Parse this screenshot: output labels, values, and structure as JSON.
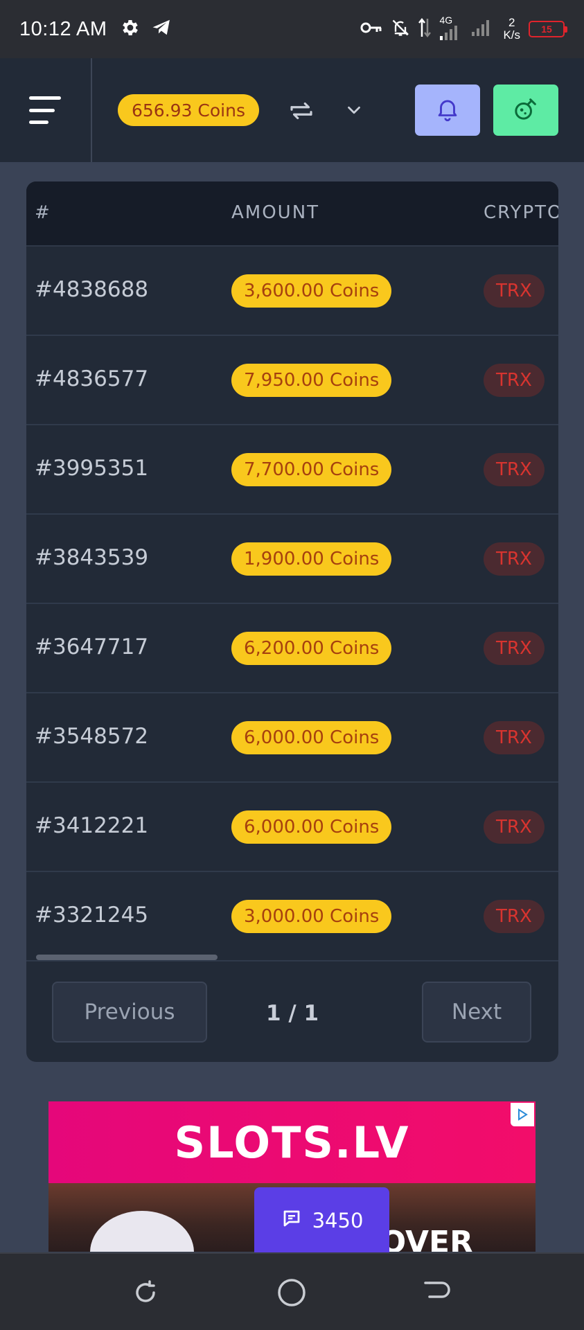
{
  "status_bar": {
    "time": "10:12 AM",
    "network": "4G",
    "speed_value": "2",
    "speed_unit": "K/s",
    "battery": "15"
  },
  "header": {
    "balance": "656.93 Coins",
    "colors": {
      "balance_bg": "#f9c81d",
      "bell_bg": "#a5b4fc",
      "gift_bg": "#5eeba4"
    }
  },
  "table": {
    "columns": [
      "#",
      "AMOUNT",
      "CRYPTO"
    ],
    "rows": [
      {
        "id": "#4838688",
        "amount": "3,600.00 Coins",
        "crypto": "TRX"
      },
      {
        "id": "#4836577",
        "amount": "7,950.00 Coins",
        "crypto": "TRX"
      },
      {
        "id": "#3995351",
        "amount": "7,700.00 Coins",
        "crypto": "TRX"
      },
      {
        "id": "#3843539",
        "amount": "1,900.00 Coins",
        "crypto": "TRX"
      },
      {
        "id": "#3647717",
        "amount": "6,200.00 Coins",
        "crypto": "TRX"
      },
      {
        "id": "#3548572",
        "amount": "6,000.00 Coins",
        "crypto": "TRX"
      },
      {
        "id": "#3412221",
        "amount": "6,000.00 Coins",
        "crypto": "TRX"
      },
      {
        "id": "#3321245",
        "amount": "3,000.00 Coins",
        "crypto": "TRX"
      }
    ]
  },
  "pagination": {
    "previous_label": "Previous",
    "page_info": "1 / 1",
    "next_label": "Next"
  },
  "ad": {
    "logo_text": "SLOTS.LV",
    "partial_text": "OVER"
  },
  "chat": {
    "count": "3450"
  }
}
